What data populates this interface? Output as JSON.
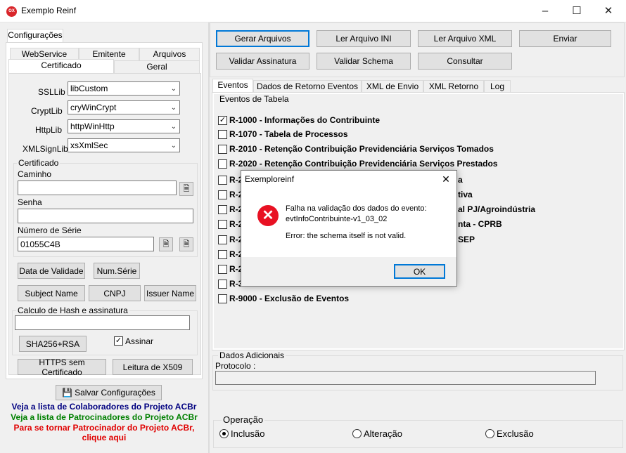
{
  "window": {
    "title": "Exemplo Reinf",
    "icon_text": "OX",
    "controls": [
      "–",
      "☐",
      "✕"
    ]
  },
  "left": {
    "group_tab": "Configurações",
    "tabs_row1": [
      "WebService",
      "Emitente",
      "Arquivos"
    ],
    "tabs_row2": [
      "Certificado",
      "Geral"
    ],
    "fields": [
      {
        "label": "SSLLib",
        "value": "libCustom"
      },
      {
        "label": "CryptLib",
        "value": "cryWinCrypt"
      },
      {
        "label": "HttpLib",
        "value": "httpWinHttp"
      },
      {
        "label": "XMLSignLib",
        "value": "xsXmlSec"
      }
    ],
    "cert_group": "Certificado",
    "caminho_label": "Caminho",
    "caminho_value": "",
    "senha_label": "Senha",
    "senha_value": "",
    "serie_label": "Número de Série",
    "serie_value": "01055C4B",
    "buttons": {
      "data_validade": "Data de Validade",
      "num_serie": "Num.Série",
      "subject": "Subject Name",
      "cnpj": "CNPJ",
      "issuer": "Issuer Name",
      "sha": "SHA256+RSA",
      "https": "HTTPS sem Certificado",
      "leitura": "Leitura de X509",
      "salvar": "Salvar Configurações"
    },
    "hash_group": "Calculo de Hash e assinatura",
    "hash_value": "",
    "assinar_label": "Assinar",
    "links": {
      "colab": "Veja a lista de Colaboradores do Projeto ACBr",
      "patro": "Veja a lista de Patrocinadores do Projeto ACBr",
      "tornar1": "Para se tornar Patrocinador do Projeto ACBr,",
      "tornar2": "clique aqui"
    },
    "link_colors": {
      "colab": "#000080",
      "patro": "#008000",
      "tornar": "#e00000"
    }
  },
  "toolbar": {
    "gerar": "Gerar Arquivos",
    "ler_ini": "Ler Arquivo INI",
    "ler_xml": "Ler Arquivo XML",
    "enviar": "Enviar",
    "validar_ass": "Validar Assinatura",
    "validar_schema": "Validar Schema",
    "consultar": "Consultar"
  },
  "right_tabs": [
    "Eventos",
    "Dados de Retorno Eventos",
    "XML de Envio",
    "XML Retorno",
    "Log"
  ],
  "eventos_group": "Eventos de Tabela",
  "events": [
    {
      "label": "R-1000 - Informações do Contribuinte",
      "checked": true
    },
    {
      "label": "R-1070 - Tabela de Processos",
      "checked": false
    },
    {
      "label": "R-2010 - Retenção Contribuição Previdenciária  Serviços Tomados",
      "checked": false
    },
    {
      "label": "R-2020 - Retenção Contribuição Previdenciária  Serviços Prestados",
      "checked": false
    },
    {
      "label": "R-2",
      "suffix": "a",
      "checked": false
    },
    {
      "label": "R-2",
      "suffix": "tiva",
      "checked": false
    },
    {
      "label": "R-2",
      "suffix": "al PJ/Agroindústria",
      "checked": false
    },
    {
      "label": "R-2",
      "suffix": "nta - CPRB",
      "checked": false
    },
    {
      "label": "R-2",
      "suffix": "SEP",
      "checked": false
    },
    {
      "label": "R-2",
      "suffix": "",
      "checked": false
    },
    {
      "label": "R-2",
      "suffix": "",
      "checked": false
    },
    {
      "label": "R-3",
      "suffix": "",
      "checked": false
    },
    {
      "label": "R-9000 - Exclusão de Eventos",
      "checked": false
    }
  ],
  "dados_group": "Dados Adicionais",
  "protocolo_label": "Protocolo :",
  "protocolo_value": "",
  "operacao": {
    "title": "Operação",
    "options": [
      "Inclusão",
      "Alteração",
      "Exclusão"
    ],
    "selected": 0
  },
  "dialog": {
    "title": "Exemploreinf",
    "line1": "Falha na validação dos dados do evento:",
    "line2": "evtInfoContribuinte-v1_03_02",
    "line3": "Error: the schema itself is not valid.",
    "ok": "OK",
    "icon_color": "#e81123"
  }
}
